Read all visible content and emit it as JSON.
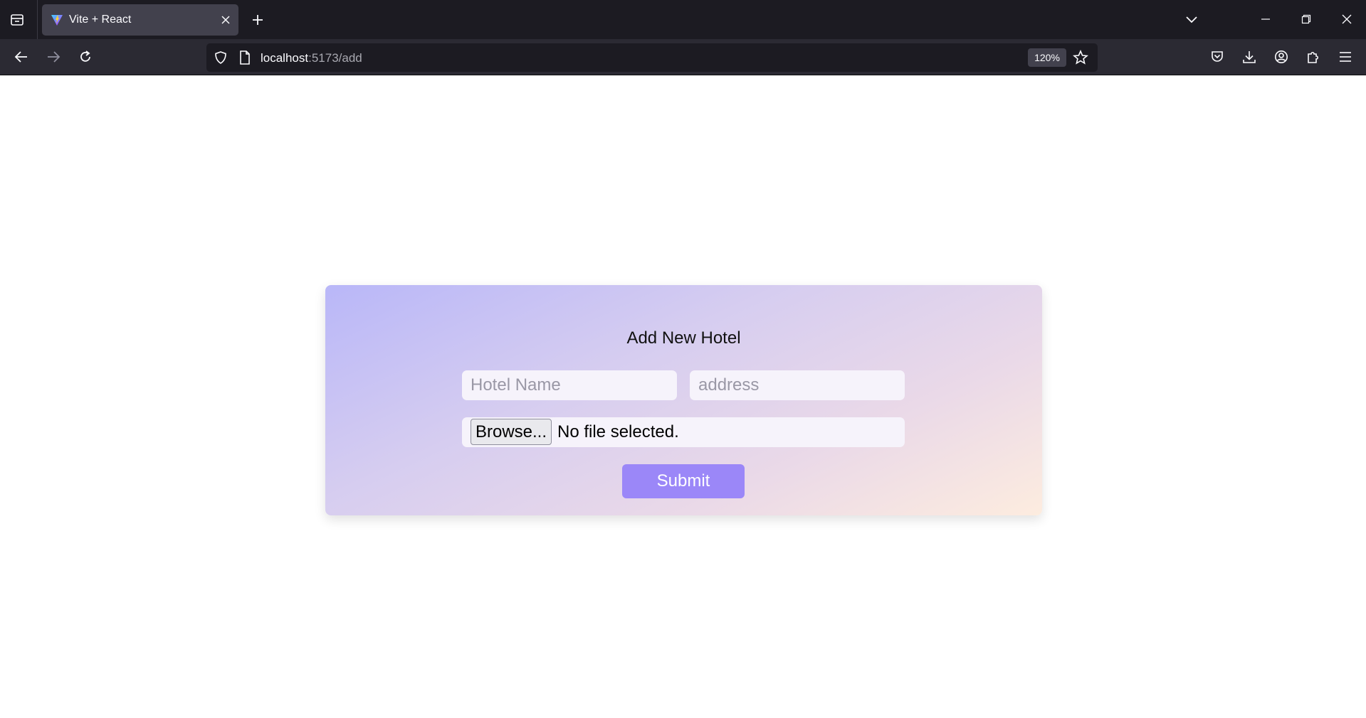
{
  "browser": {
    "tab": {
      "title": "Vite + React"
    },
    "url": {
      "host": "localhost",
      "path": ":5173/add"
    },
    "zoom": "120%"
  },
  "page": {
    "title": "Add New Hotel",
    "hotel_name_placeholder": "Hotel Name",
    "address_placeholder": "address",
    "browse_label": "Browse...",
    "file_status": "No file selected.",
    "submit_label": "Submit"
  },
  "colors": {
    "submit": "#9b87f8",
    "card_gradient_start": "#b9b7f8",
    "card_gradient_end": "#fdecdf"
  }
}
